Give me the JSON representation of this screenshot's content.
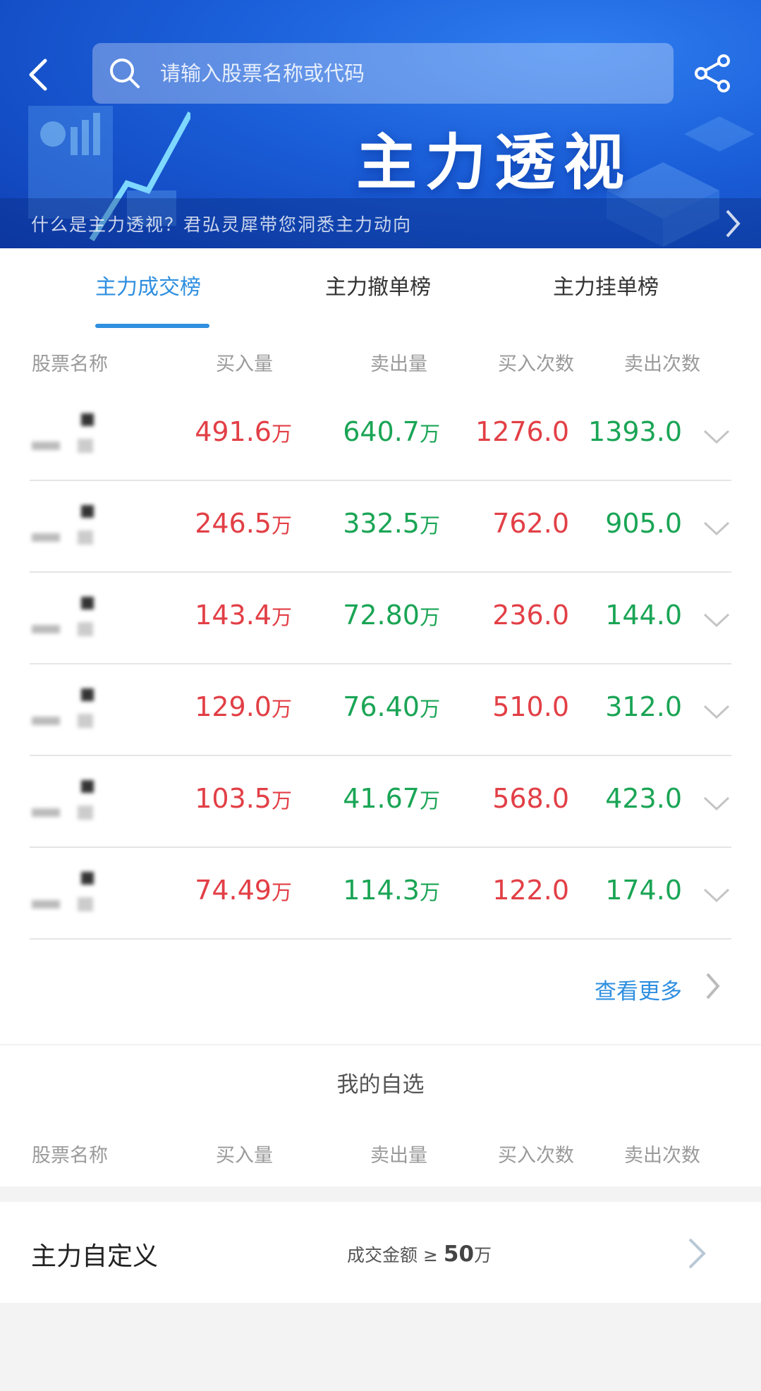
{
  "header": {
    "search_placeholder": "请输入股票名称或代码",
    "banner_title": "主力透视",
    "info_text": "什么是主力透视？君弘灵犀带您洞悉主力动向"
  },
  "tabs": [
    {
      "label": "主力成交榜",
      "active": true
    },
    {
      "label": "主力撤单榜",
      "active": false
    },
    {
      "label": "主力挂单榜",
      "active": false
    }
  ],
  "columns": {
    "name": "股票名称",
    "buy_volume": "买入量",
    "sell_volume": "卖出量",
    "buy_count": "买入次数",
    "sell_count": "卖出次数"
  },
  "rows": [
    {
      "buy_volume": "491.6",
      "sell_volume": "640.7",
      "buy_count": "1276.0",
      "sell_count": "1393.0"
    },
    {
      "buy_volume": "246.5",
      "sell_volume": "332.5",
      "buy_count": "762.0",
      "sell_count": "905.0"
    },
    {
      "buy_volume": "143.4",
      "sell_volume": "72.80",
      "buy_count": "236.0",
      "sell_count": "144.0"
    },
    {
      "buy_volume": "129.0",
      "sell_volume": "76.40",
      "buy_count": "510.0",
      "sell_count": "312.0"
    },
    {
      "buy_volume": "103.5",
      "sell_volume": "41.67",
      "buy_count": "568.0",
      "sell_count": "423.0"
    },
    {
      "buy_volume": "74.49",
      "sell_volume": "114.3",
      "buy_count": "122.0",
      "sell_count": "174.0"
    }
  ],
  "unit": "万",
  "more_label": "查看更多",
  "watchlist": {
    "title": "我的自选"
  },
  "custom": {
    "title": "主力自定义",
    "condition_prefix": "成交金额",
    "condition_op": "≥",
    "condition_value": "50",
    "condition_unit": "万"
  },
  "colors": {
    "accent": "#2f8fe0",
    "buy_red": "#e23f46",
    "sell_green": "#1aa555"
  }
}
